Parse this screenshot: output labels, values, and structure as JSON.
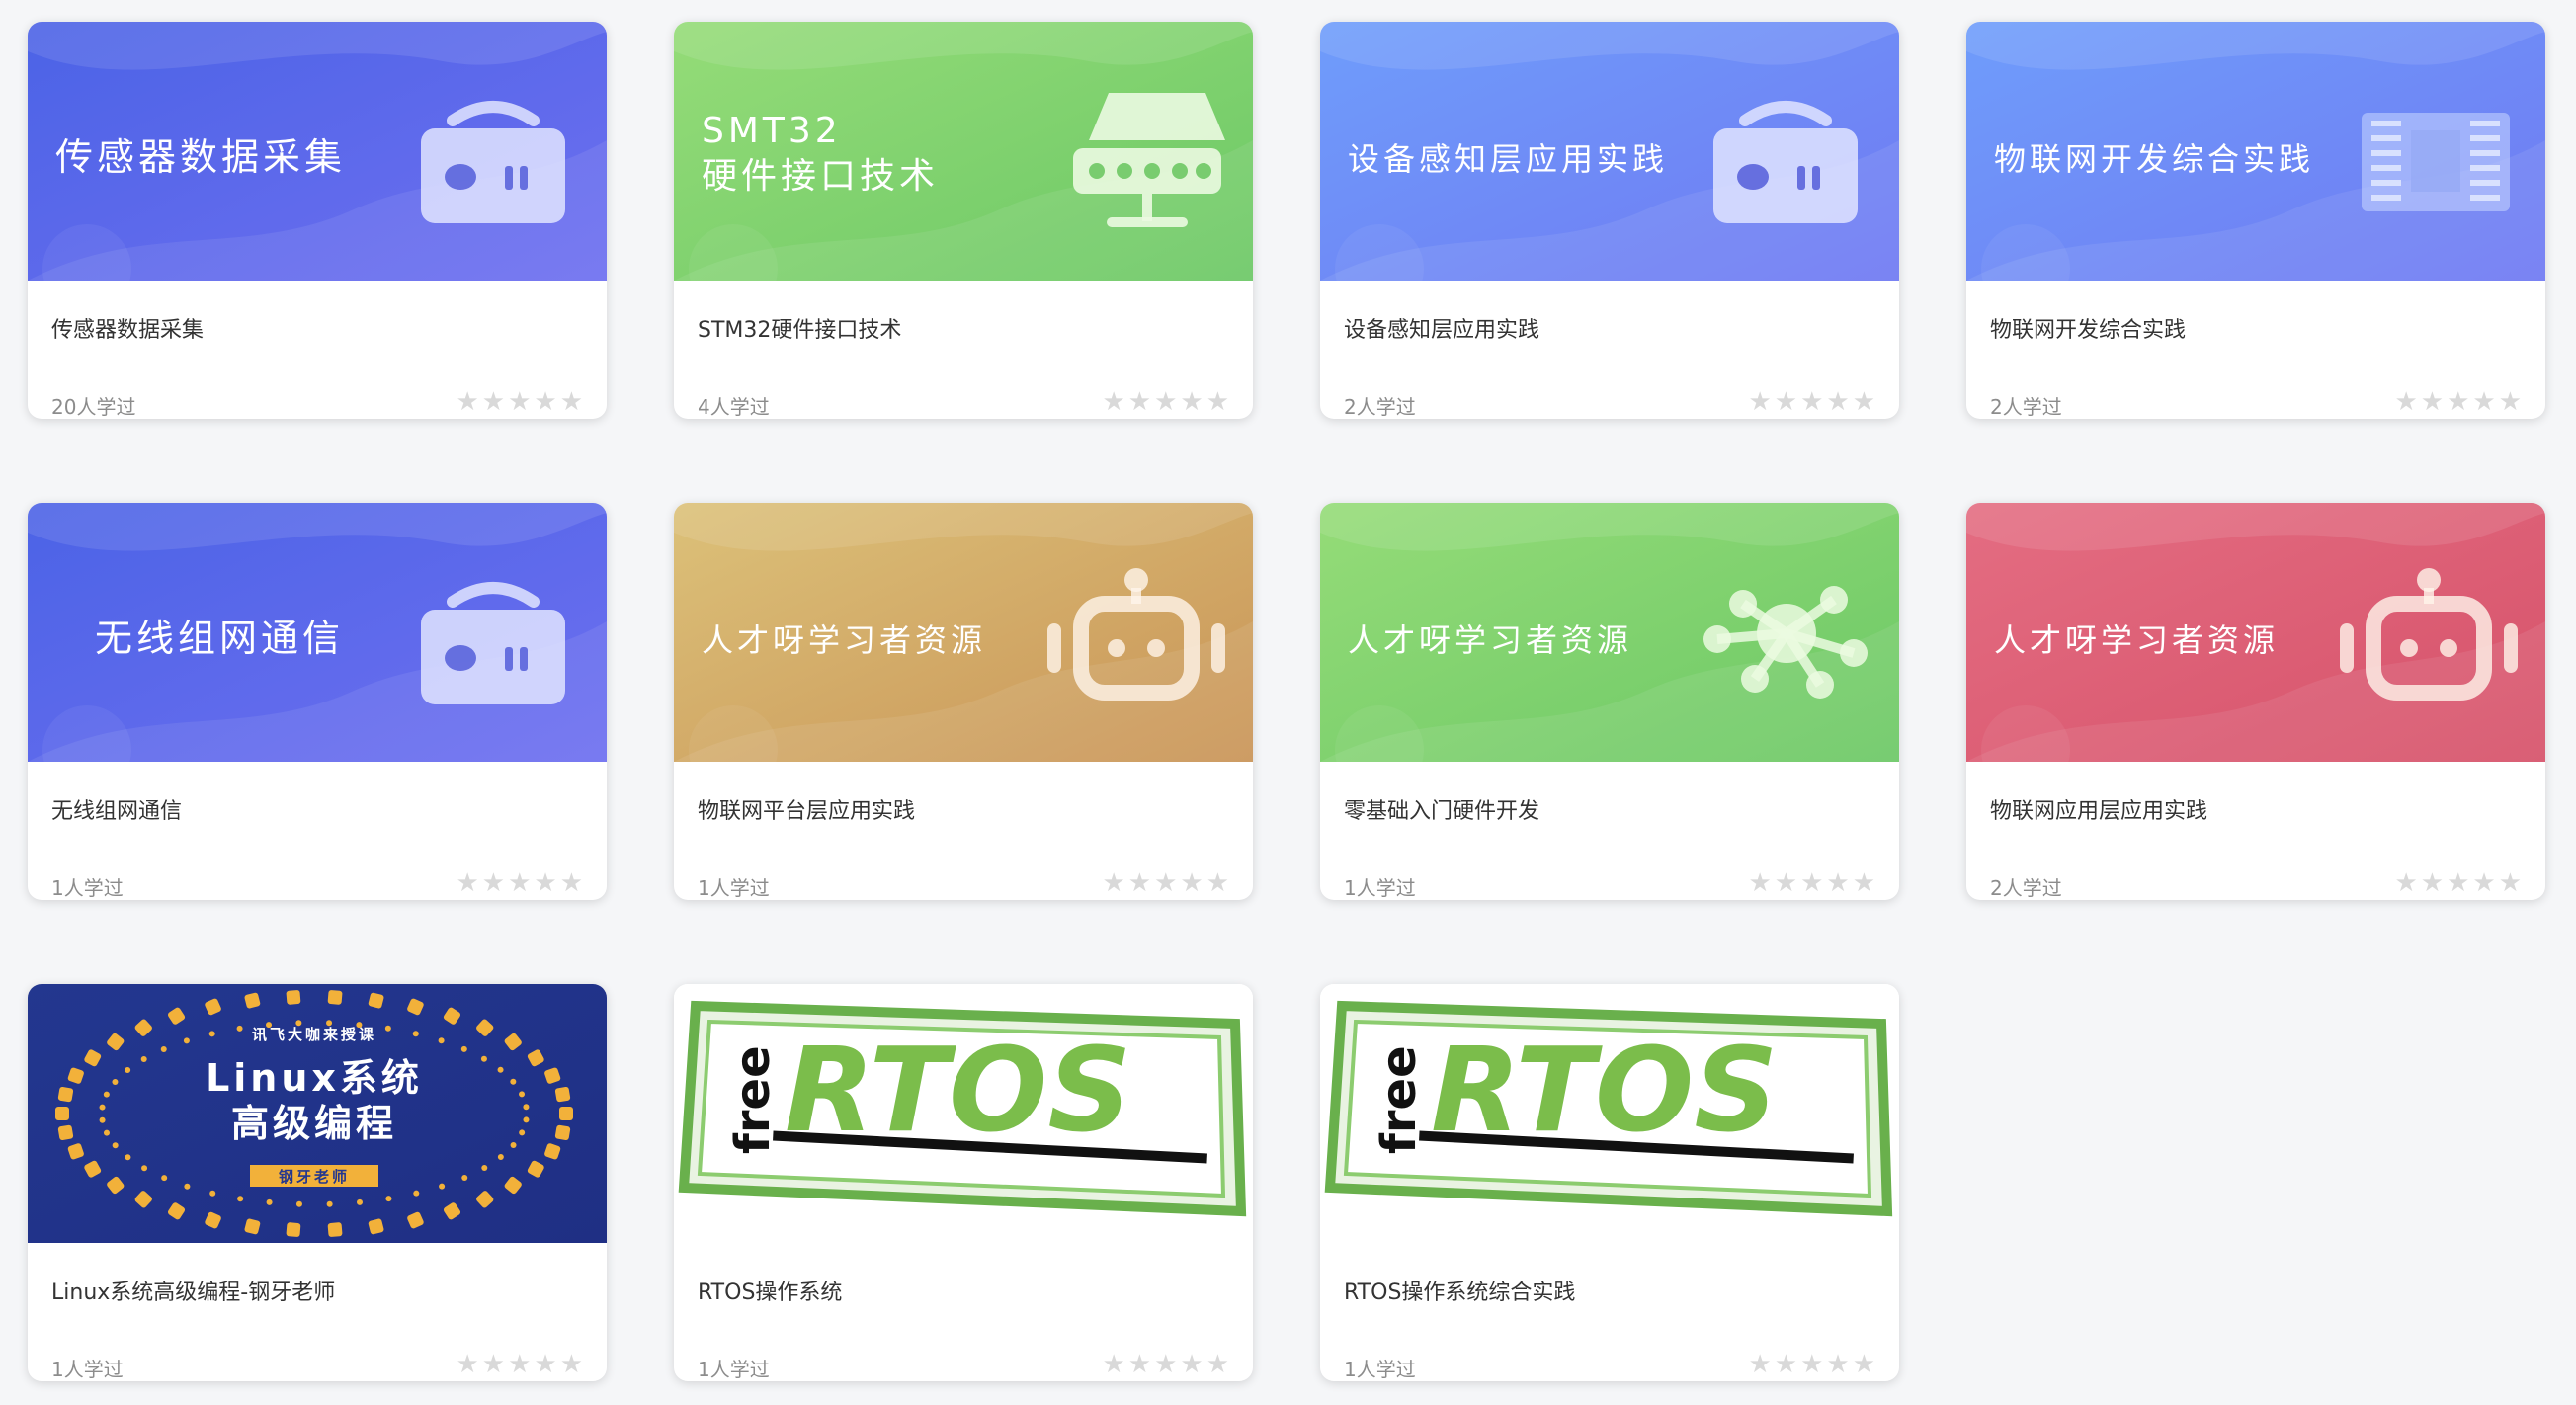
{
  "courses": [
    {
      "title": "传感器数据采集",
      "cover_text": "传感器数据采集",
      "learners": "20人学过",
      "rating": 0,
      "theme": "blue",
      "icon": "router-icon"
    },
    {
      "title": "STM32硬件接口技术",
      "cover_text": "SMT32\n硬件接口技术",
      "learners": "4人学过",
      "rating": 0,
      "theme": "green",
      "icon": "network-switch-icon"
    },
    {
      "title": "设备感知层应用实践",
      "cover_text": "设备感知层应用实践",
      "learners": "2人学过",
      "rating": 0,
      "theme": "lightblue",
      "icon": "router-icon"
    },
    {
      "title": "物联网开发综合实践",
      "cover_text": "物联网开发综合实践",
      "learners": "2人学过",
      "rating": 0,
      "theme": "lightblue",
      "icon": "circuit-board-icon"
    },
    {
      "title": "无线组网通信",
      "cover_text": "无线组网通信",
      "learners": "1人学过",
      "rating": 0,
      "theme": "blue",
      "icon": "router-icon"
    },
    {
      "title": "物联网平台层应用实践",
      "cover_text": "人才呀学习者资源",
      "learners": "1人学过",
      "rating": 0,
      "theme": "gold",
      "icon": "robot-icon"
    },
    {
      "title": "零基础入门硬件开发",
      "cover_text": "人才呀学习者资源",
      "learners": "1人学过",
      "rating": 0,
      "theme": "green",
      "icon": "molecule-icon"
    },
    {
      "title": "物联网应用层应用实践",
      "cover_text": "人才呀学习者资源",
      "learners": "2人学过",
      "rating": 0,
      "theme": "red",
      "icon": "robot-icon"
    },
    {
      "title": "Linux系统高级编程-钢牙老师",
      "cover_text": "Linux系统\n高级编程",
      "cover_top": "讯飞大咖来授课",
      "cover_badge": "钢牙老师",
      "learners": "1人学过",
      "rating": 0,
      "theme": "linux",
      "icon": "dotted-ring-icon"
    },
    {
      "title": "RTOS操作系统",
      "cover_text": "RTOS",
      "cover_small": "free",
      "learners": "1人学过",
      "rating": 0,
      "theme": "rtos",
      "icon": "freertos-logo"
    },
    {
      "title": "RTOS操作系统综合实践",
      "cover_text": "RTOS",
      "cover_small": "free",
      "learners": "1人学过",
      "rating": 0,
      "theme": "rtos",
      "icon": "freertos-logo"
    }
  ],
  "colors": {
    "blue": [
      "#4b63e6",
      "#6e6ff0"
    ],
    "lightblue": [
      "#6f9dfb",
      "#6f79f2"
    ],
    "green": [
      "#95dc78",
      "#6cc866"
    ],
    "gold": [
      "#dcc179",
      "#c99457"
    ],
    "red": [
      "#e46d82",
      "#d6526a"
    ],
    "linux": [
      "#23378f",
      "#1f2f84"
    ],
    "rtos": [
      "#ffffff",
      "#ffffff"
    ],
    "star": "#d9d9d9",
    "title": "#333333",
    "meta": "#8c8c8c"
  }
}
